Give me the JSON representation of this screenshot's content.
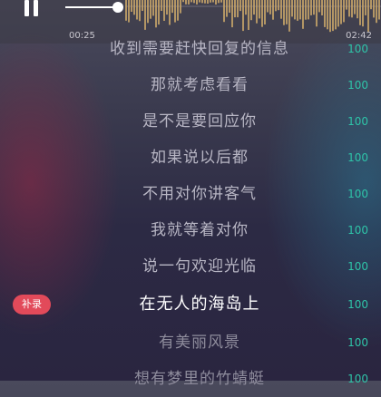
{
  "player": {
    "elapsed": "00:25",
    "total": "02:42",
    "colors": {
      "accent": "#2ec4a8",
      "waveform": "#c8a56a",
      "tag": "#e24a5a"
    }
  },
  "lyrics": [
    {
      "text": "收到需要赶快回复的信息",
      "score": "100"
    },
    {
      "text": "那就考虑看看",
      "score": "100"
    },
    {
      "text": "是不是要回应你",
      "score": "100"
    },
    {
      "text": "如果说以后都",
      "score": "100"
    },
    {
      "text": "不用对你讲客气",
      "score": "100"
    },
    {
      "text": "我就等着对你",
      "score": "100"
    },
    {
      "text": "说一句欢迎光临",
      "score": "100"
    },
    {
      "text": "在无人的海岛上",
      "score": "100",
      "tag": "补录"
    },
    {
      "text": "有美丽风景",
      "score": "100"
    },
    {
      "text": "想有梦里的竹蜻蜓",
      "score": "100"
    }
  ]
}
